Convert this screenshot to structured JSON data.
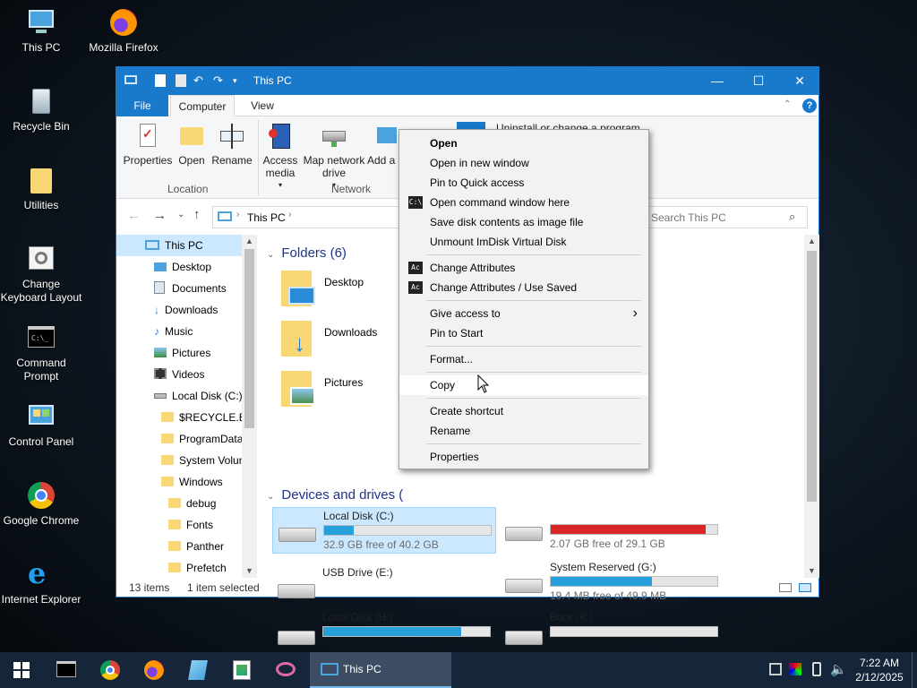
{
  "desktop": {
    "icons": [
      {
        "label": "This PC",
        "icon": "this-pc-icon"
      },
      {
        "label": "Mozilla Firefox",
        "icon": "firefox-icon"
      },
      {
        "label": "Recycle Bin",
        "icon": "recycle-bin-icon"
      },
      {
        "label": "Utilities",
        "icon": "folder-icon"
      },
      {
        "label": "Change Keyboard Layout",
        "icon": "keyboard-settings-icon"
      },
      {
        "label": "Command Prompt",
        "icon": "command-prompt-icon"
      },
      {
        "label": "Control Panel",
        "icon": "control-panel-icon"
      },
      {
        "label": "Google Chrome",
        "icon": "chrome-icon"
      },
      {
        "label": "Internet Explorer",
        "icon": "internet-explorer-icon"
      }
    ]
  },
  "window": {
    "title": "This PC",
    "controls": {
      "minimize": "—",
      "maximize": "☐",
      "close": "✕"
    },
    "tabs": [
      "File",
      "Computer",
      "View"
    ],
    "ribbon": {
      "buttons": [
        {
          "label": "Properties",
          "icon": "properties-icon"
        },
        {
          "label": "Open",
          "icon": "open-folder-icon"
        },
        {
          "label": "Rename",
          "icon": "rename-icon"
        },
        {
          "label": "Access media",
          "icon": "access-media-icon"
        },
        {
          "label": "Map network drive",
          "icon": "map-drive-icon"
        },
        {
          "label": "Add a loc",
          "icon": "add-location-icon"
        }
      ],
      "groups": [
        "Location",
        "Network"
      ],
      "partial_item": "Uninstall or change a program"
    },
    "address": {
      "path": "This PC",
      "search_placeholder": "Search This PC"
    },
    "nav": [
      {
        "label": "This PC",
        "level": 0,
        "icon": "this-pc-icon"
      },
      {
        "label": "Desktop",
        "level": 1,
        "icon": "desktop-icon"
      },
      {
        "label": "Documents",
        "level": 1,
        "icon": "documents-icon"
      },
      {
        "label": "Downloads",
        "level": 1,
        "icon": "downloads-icon"
      },
      {
        "label": "Music",
        "level": 1,
        "icon": "music-icon"
      },
      {
        "label": "Pictures",
        "level": 1,
        "icon": "pictures-icon"
      },
      {
        "label": "Videos",
        "level": 1,
        "icon": "videos-icon"
      },
      {
        "label": "Local Disk (C:)",
        "level": 1,
        "icon": "drive-icon"
      },
      {
        "label": "$RECYCLE.BIN",
        "level": 2,
        "icon": "folder-icon"
      },
      {
        "label": "ProgramData",
        "level": 2,
        "icon": "folder-icon"
      },
      {
        "label": "System Volun",
        "level": 2,
        "icon": "folder-icon"
      },
      {
        "label": "Windows",
        "level": 2,
        "icon": "folder-icon"
      },
      {
        "label": "debug",
        "level": 3,
        "icon": "folder-icon"
      },
      {
        "label": "Fonts",
        "level": 3,
        "icon": "folder-icon"
      },
      {
        "label": "Panther",
        "level": 3,
        "icon": "folder-icon"
      },
      {
        "label": "Prefetch",
        "level": 3,
        "icon": "folder-icon"
      }
    ],
    "sections": {
      "folders": "Folders (6)",
      "devices": "Devices and drives ("
    },
    "folders": [
      {
        "label": "Desktop",
        "icon": "desktop-folder-icon"
      },
      {
        "label": "Downloads",
        "icon": "downloads-folder-icon"
      },
      {
        "label": "Pictures",
        "icon": "pictures-folder-icon"
      }
    ],
    "drives": [
      {
        "name": "Local Disk (C:)",
        "free": "32.9 GB free of 40.2 GB",
        "used": 0.18,
        "color": "#26a0da",
        "selected": true
      },
      {
        "name": "",
        "free": "2.07 GB free of 29.1 GB",
        "used": 0.93,
        "color": "#da2626",
        "selected": false
      },
      {
        "name": "USB Drive (E:)",
        "free": "",
        "used": null,
        "color": "#26a0da",
        "selected": false
      },
      {
        "name": "System Reserved (G:)",
        "free": "19.4 MB free of 49.9 MB",
        "used": 0.61,
        "color": "#26a0da",
        "selected": false
      },
      {
        "name": "Local Disk (H:)",
        "free": "",
        "used": 0.83,
        "color": "#26a0da",
        "selected": false
      },
      {
        "name": "Boot (X:)",
        "free": "",
        "used": 0.0,
        "color": "#26a0da",
        "selected": false
      }
    ],
    "status": {
      "items": "13 items",
      "selected": "1 item selected"
    }
  },
  "context_menu": {
    "groups": [
      [
        {
          "label": "Open",
          "bold": true
        },
        {
          "label": "Open in new window"
        },
        {
          "label": "Pin to Quick access"
        },
        {
          "label": "Open command window here",
          "icon": "cmd-icon"
        },
        {
          "label": "Save disk contents as image file"
        },
        {
          "label": "Unmount ImDisk Virtual Disk"
        }
      ],
      [
        {
          "label": "Change Attributes",
          "icon": "attrib-icon"
        },
        {
          "label": "Change Attributes / Use Saved",
          "icon": "attrib-icon"
        }
      ],
      [
        {
          "label": "Give access to",
          "submenu": true
        },
        {
          "label": "Pin to Start"
        }
      ],
      [
        {
          "label": "Format..."
        }
      ],
      [
        {
          "label": "Copy",
          "hovered": true
        }
      ],
      [
        {
          "label": "Create shortcut"
        },
        {
          "label": "Rename"
        }
      ],
      [
        {
          "label": "Properties"
        }
      ]
    ]
  },
  "taskbar": {
    "apps": [
      {
        "icon": "start-icon"
      },
      {
        "icon": "command-prompt-icon"
      },
      {
        "icon": "chrome-icon"
      },
      {
        "icon": "firefox-icon"
      },
      {
        "icon": "notepad-icon"
      },
      {
        "icon": "paint-icon"
      },
      {
        "icon": "snipping-tool-icon"
      }
    ],
    "active_window": "This PC",
    "time": "7:22 AM",
    "date": "2/12/2025",
    "colors": {
      "taskbar": "#15253a",
      "accent": "#1979ca"
    }
  }
}
